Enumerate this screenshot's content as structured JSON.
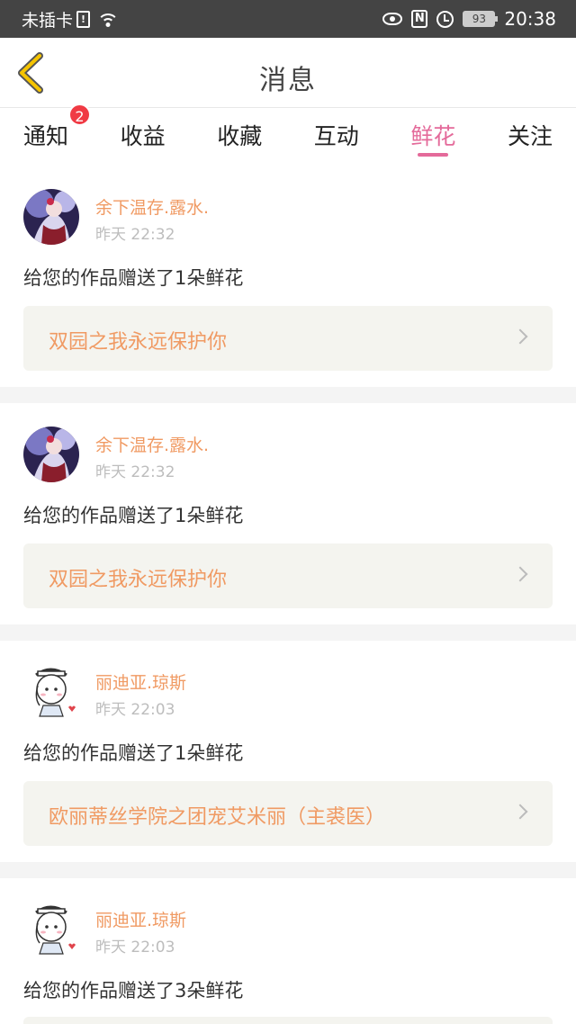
{
  "status_bar": {
    "carrier": "未插卡",
    "sim_icon": "sim-alert-icon",
    "sim_glyph": "!",
    "nfc_glyph": "N",
    "battery": "93",
    "time": "20:38"
  },
  "header": {
    "title": "消息",
    "back_icon": "chevron-left-icon",
    "accent_color": "#f5c400"
  },
  "tabs": [
    {
      "label": "通知",
      "badge": "2"
    },
    {
      "label": "收益"
    },
    {
      "label": "收藏"
    },
    {
      "label": "互动"
    },
    {
      "label": "鲜花",
      "active": true
    },
    {
      "label": "关注"
    }
  ],
  "colors": {
    "active_tab": "#e46a9a",
    "name": "#f09a63",
    "badge": "#f03a44"
  },
  "messages": [
    {
      "name": "余下温存.露水.",
      "time": "昨天 22:32",
      "text": "给您的作品赠送了1朵鲜花",
      "work": "双园之我永远保护你",
      "avatar": "anime-girl-avatar"
    },
    {
      "name": "余下温存.露水.",
      "time": "昨天 22:32",
      "text": "给您的作品赠送了1朵鲜花",
      "work": "双园之我永远保护你",
      "avatar": "anime-girl-avatar"
    },
    {
      "name": "丽迪亚.琼斯",
      "time": "昨天 22:03",
      "text": "给您的作品赠送了1朵鲜花",
      "work": "欧丽蒂丝学院之团宠艾米丽（主裘医）",
      "avatar": "chibi-nurse-avatar"
    },
    {
      "name": "丽迪亚.琼斯",
      "time": "昨天 22:03",
      "text": "给您的作品赠送了3朵鲜花",
      "work": "",
      "avatar": "chibi-nurse-avatar"
    }
  ]
}
